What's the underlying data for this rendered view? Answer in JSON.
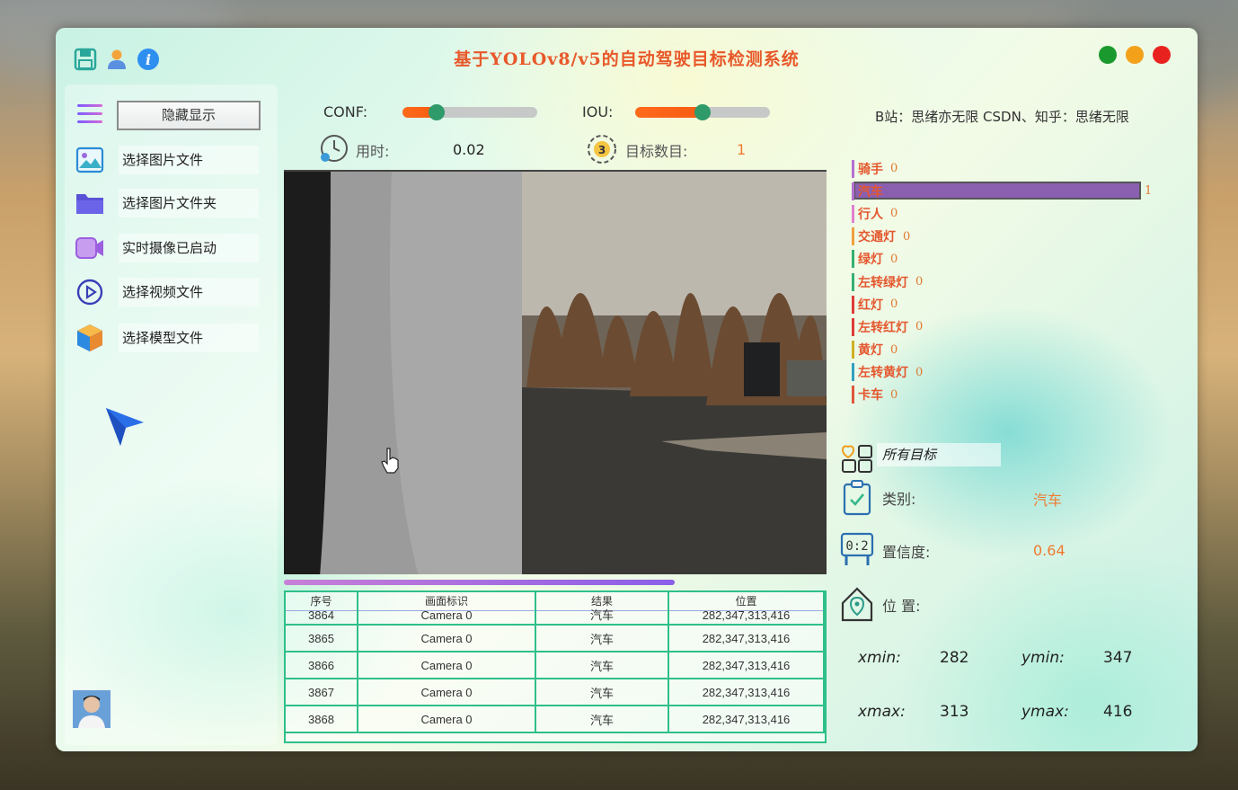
{
  "app": {
    "title": "基于YOLOv8/v5的自动驾驶目标检测系统",
    "credit": "B站：思绪亦无限 CSDN、知乎：思绪无限"
  },
  "sidebar": {
    "hide_button": "隐藏显示",
    "items": [
      {
        "label": "选择图片文件",
        "icon": "image-icon"
      },
      {
        "label": "选择图片文件夹",
        "icon": "folder-icon"
      },
      {
        "label": "实时摄像已启动",
        "icon": "camera-icon"
      },
      {
        "label": "选择视频文件",
        "icon": "play-icon"
      },
      {
        "label": "选择模型文件",
        "icon": "cube-icon"
      }
    ]
  },
  "controls": {
    "conf_label": "CONF:",
    "conf_value": 0.25,
    "iou_label": "IOU:",
    "iou_value": 0.5,
    "time_label": "用时:",
    "time_value": "0.02",
    "count_label": "目标数目:",
    "count_value": "1"
  },
  "progress": 0.72,
  "table": {
    "headers": [
      "序号",
      "画面标识",
      "结果",
      "位置"
    ],
    "rows": [
      [
        "3864",
        "Camera 0",
        "汽车",
        "282,347,313,416"
      ],
      [
        "3865",
        "Camera 0",
        "汽车",
        "282,347,313,416"
      ],
      [
        "3866",
        "Camera 0",
        "汽车",
        "282,347,313,416"
      ],
      [
        "3867",
        "Camera 0",
        "汽车",
        "282,347,313,416"
      ],
      [
        "3868",
        "Camera 0",
        "汽车",
        "282,347,313,416"
      ]
    ]
  },
  "classes": [
    {
      "name": "骑手",
      "count": "0",
      "color": "#e4572e"
    },
    {
      "name": "汽车",
      "count": "1",
      "color": "#e4572e",
      "fraction": 1.0
    },
    {
      "name": "行人",
      "count": "0",
      "color": "#e4572e"
    },
    {
      "name": "交通灯",
      "count": "0",
      "color": "#e4572e"
    },
    {
      "name": "绿灯",
      "count": "0",
      "color": "#e4572e"
    },
    {
      "name": "左转绿灯",
      "count": "0",
      "color": "#e4572e"
    },
    {
      "name": "红灯",
      "count": "0",
      "color": "#e4572e"
    },
    {
      "name": "左转红灯",
      "count": "0",
      "color": "#e4572e"
    },
    {
      "name": "黄灯",
      "count": "0",
      "color": "#e4572e"
    },
    {
      "name": "左转黄灯",
      "count": "0",
      "color": "#e4572e"
    },
    {
      "name": "卡车",
      "count": "0",
      "color": "#e4572e"
    }
  ],
  "detail": {
    "target_select": "所有目标",
    "class_label": "类别:",
    "class_value": "汽车",
    "conf_label": "置信度:",
    "conf_value": "0.64",
    "pos_label": "位 置:",
    "xmin_label": "xmin:",
    "xmin": "282",
    "ymin_label": "ymin:",
    "ymin": "347",
    "xmax_label": "xmax:",
    "xmax": "313",
    "ymax_label": "ymax:",
    "ymax": "416"
  }
}
